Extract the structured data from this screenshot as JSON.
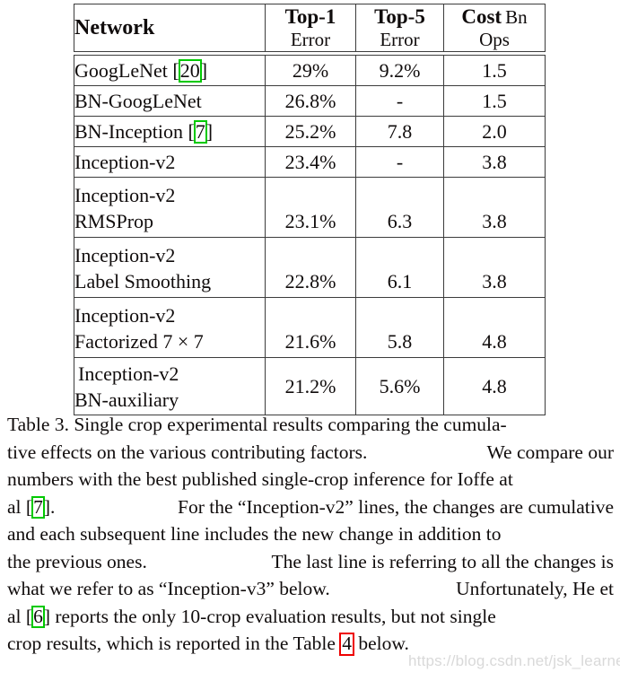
{
  "table": {
    "columns": [
      {
        "top": "Network",
        "sub": ""
      },
      {
        "top": "Top-1",
        "sub": "Error"
      },
      {
        "top": "Top-5",
        "sub": "Error"
      },
      {
        "top": "Cost",
        "sub": "Bn Ops"
      }
    ],
    "rows": [
      {
        "network_line1": "GoogLeNet [",
        "ref": "20",
        "network_line1_after": "]",
        "network_line2": "",
        "top1": "29%",
        "top5": "9.2%",
        "cost": "1.5"
      },
      {
        "network_line1": "BN-GoogLeNet",
        "network_line2": "",
        "top1": "26.8%",
        "top5": "-",
        "cost": "1.5"
      },
      {
        "network_line1": "BN-Inception [",
        "ref": "7",
        "network_line1_after": "]",
        "network_line2": "",
        "top1": "25.2%",
        "top5": "7.8",
        "cost": "2.0"
      },
      {
        "network_line1": "Inception-v2",
        "network_line2": "",
        "top1": "23.4%",
        "top5": "-",
        "cost": "3.8"
      },
      {
        "network_line1": "Inception-v2",
        "network_line2": "RMSProp",
        "top1": "23.1%",
        "top5": "6.3",
        "cost": "3.8"
      },
      {
        "network_line1": "Inception-v2",
        "network_line2": "Label Smoothing",
        "top1": "22.8%",
        "top5": "6.1",
        "cost": "3.8"
      },
      {
        "network_line1": "Inception-v2",
        "network_line2": "Factorized 7 × 7",
        "top1": "21.6%",
        "top5": "5.8",
        "cost": "4.8"
      },
      {
        "network_line1": "Inception-v2",
        "network_line2": "BN-auxiliary",
        "top1": "21.2%",
        "top5": "5.6%",
        "cost": "4.8"
      }
    ]
  },
  "caption": {
    "line1": "Table 3. Single crop experimental results comparing the cumula-",
    "line2_a": "tive effects on the various contributing factors.",
    "line2_b": "We compare our",
    "line3": "numbers with the best published single-crop inference for Ioffe at",
    "line4_pre": "al [",
    "line4_ref": "7",
    "line4_a": "].",
    "line4_b": "For the “Inception-v2” lines, the changes are cumulative",
    "line5": "and each subsequent line includes the new change in addition to",
    "line6_a": "the previous ones.",
    "line6_b": "The last line is referring to all the changes is",
    "line7_a": "what we refer to as “Inception-v3” below.",
    "line7_b": "Unfortunately, He et",
    "line8_pre": "al [",
    "line8_ref": "6",
    "line8_post": "] reports the only 10-crop evaluation results, but not single",
    "line9_pre": "crop results, which is reported in the Table ",
    "line9_ref": "4",
    "line9_post": " below."
  },
  "watermark": {
    "text": "https://blog.csdn.net/jsk_learner"
  },
  "colors": {
    "citation_box_green": "#00c900",
    "table_ref_box_red": "#ee0000",
    "text": "#100c0c",
    "rule": "#3c3c3c",
    "watermark": "#d9d9d9"
  }
}
